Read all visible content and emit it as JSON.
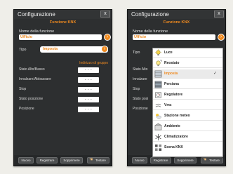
{
  "panels": [
    {
      "title": "Configurazione",
      "close_label": "x",
      "subtitle": "Funzione KNX",
      "name_label": "Nome della funzione",
      "name_value": "Ufficio",
      "type_label": "Tipo",
      "type_value": "Impostа",
      "group_address_header": "Indirizzo di gruppo",
      "rows": [
        {
          "label": "Stato Alto/Basso",
          "value": "- - -"
        },
        {
          "label": "Innalzare/Abbassare",
          "value": "- - -"
        },
        {
          "label": "Stop",
          "value": "- - -"
        },
        {
          "label": "Stato posizione",
          "value": "- - -"
        },
        {
          "label": "Posizione",
          "value": "- - -"
        }
      ],
      "footer": {
        "new": "Nuovo",
        "save": "Registrare",
        "delete": "Sopprimere",
        "test": "Testare"
      }
    },
    {
      "title": "Configurazione",
      "close_label": "x",
      "subtitle": "Funzione KNX",
      "name_label": "Nome della funzione",
      "name_value": "Ufficio",
      "type_label": "Tipo",
      "rows": [
        {
          "label": "Stato Alto"
        },
        {
          "label": "Innalzare"
        },
        {
          "label": "Stop"
        },
        {
          "label": "Stato posi"
        },
        {
          "label": "Posizione"
        }
      ],
      "footer": {
        "new": "Nuovo",
        "save": "Registrare",
        "delete": "Sopprimere",
        "test": "Testare"
      },
      "dropdown": {
        "items": [
          {
            "label": "Luce",
            "icon": "bulb-icon"
          },
          {
            "label": "Reostato",
            "icon": "dimmer-icon"
          },
          {
            "label": "Impostа",
            "icon": "blind-icon",
            "selected": true,
            "check": "✓"
          },
          {
            "label": "Persiana",
            "icon": "shutter-icon"
          },
          {
            "label": "Regolatore",
            "icon": "regulator-icon"
          },
          {
            "label": "Vmc",
            "icon": "fan-icon"
          },
          {
            "label": "Stazione meteo",
            "icon": "weather-icon"
          },
          {
            "label": "Ambiente",
            "icon": "ambience-icon"
          },
          {
            "label": "Climatizzatore",
            "icon": "snowflake-icon"
          },
          {
            "label": "Scena KNX",
            "icon": "scene-icon"
          }
        ]
      }
    }
  ],
  "colors": {
    "accent": "#ef8a1f",
    "panel_bg": "#2d2f30",
    "page_bg": "#efeee9"
  }
}
